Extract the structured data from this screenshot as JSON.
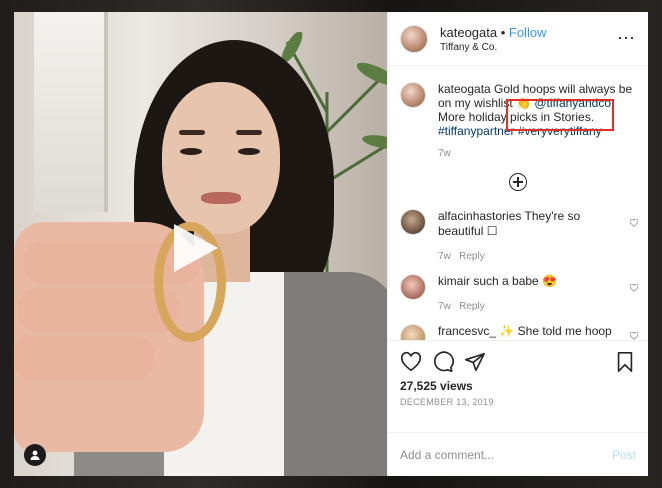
{
  "post": {
    "username": "kateogata",
    "separator": " • ",
    "follow_label": "Follow",
    "location": "Tiffany & Co."
  },
  "caption": {
    "username": "kateogata",
    "text_before": " Gold hoops will always be on my wishlist ",
    "emoji": "👏",
    "mention": "@tiffanyandco.",
    "text_after": " More holiday picks in Stories.",
    "hashtags": "#tiffanypartner #veryverytiffany",
    "age": "7w"
  },
  "comments": [
    {
      "username": "alfacinhastories",
      "text": "They're so beautiful ☐",
      "age": "7w",
      "reply": "Reply"
    },
    {
      "username": "kimair",
      "text": "such a babe 😍",
      "age": "7w",
      "reply": "Reply"
    },
    {
      "username": "francesvc_",
      "text": "✨ She told me hoop",
      "age": "",
      "reply": ""
    }
  ],
  "stats": {
    "views": "27,525 views",
    "date": "DECEMBER 13, 2019"
  },
  "composer": {
    "placeholder": "Add a comment...",
    "post_label": "Post"
  },
  "icons": [
    "play-icon",
    "user-tag-icon",
    "more-icon",
    "load-more-icon",
    "heart-icon",
    "comment-icon",
    "share-icon",
    "save-icon"
  ]
}
